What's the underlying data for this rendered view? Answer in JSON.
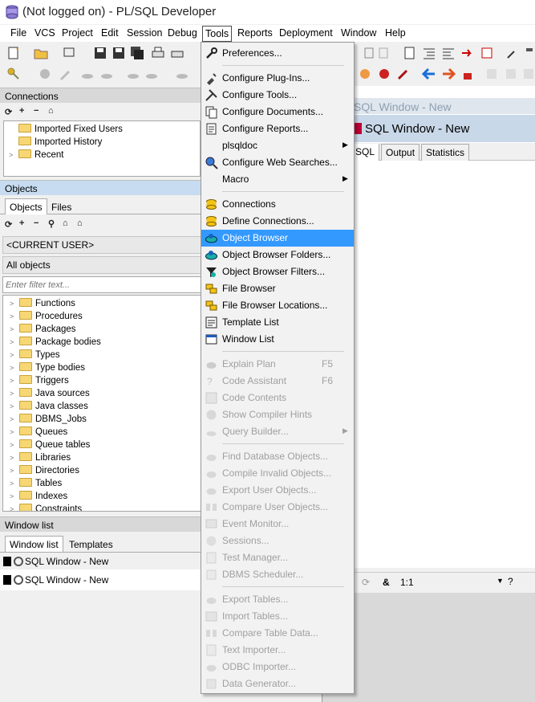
{
  "window": {
    "title": "(Not logged on) - PL/SQL Developer"
  },
  "menubar": {
    "items": [
      "File",
      "VCS",
      "Project",
      "Edit",
      "Session",
      "Debug",
      "Tools",
      "Reports",
      "Deployment",
      "Window",
      "Help"
    ]
  },
  "connections": {
    "header": "Connections",
    "items": [
      "Imported Fixed Users",
      "Imported History",
      "Recent"
    ]
  },
  "objects": {
    "header": "Objects",
    "tabs": [
      "Objects",
      "Files"
    ],
    "current_user": "<CURRENT USER>",
    "filter_selector": "All objects",
    "filter_placeholder": "Enter filter text...",
    "tree": [
      "Functions",
      "Procedures",
      "Packages",
      "Package bodies",
      "Types",
      "Type bodies",
      "Triggers",
      "Java sources",
      "Java classes",
      "DBMS_Jobs",
      "Queues",
      "Queue tables",
      "Libraries",
      "Directories",
      "Tables",
      "Indexes",
      "Constraints"
    ]
  },
  "window_list": {
    "header": "Window list",
    "tabs": [
      "Window list",
      "Templates"
    ],
    "items": [
      "SQL Window - New",
      "SQL Window - New"
    ]
  },
  "editor": {
    "title_inactive": "SQL Window - New",
    "title_active": "SQL Window - New",
    "tabs": [
      "SQL",
      "Output",
      "Statistics"
    ],
    "status_ampersand": "&",
    "status_position": "1:1",
    "status_help": "?"
  },
  "tools_menu": {
    "items": [
      {
        "label": "Preferences...",
        "icon": "wrench-icon",
        "enabled": true
      },
      {
        "label": "Configure Plug-Ins...",
        "icon": "plugin-icon",
        "enabled": true
      },
      {
        "label": "Configure Tools...",
        "icon": "tools-icon",
        "enabled": true
      },
      {
        "label": "Configure Documents...",
        "icon": "documents-icon",
        "enabled": true
      },
      {
        "label": "Configure Reports...",
        "icon": "report-icon",
        "enabled": true
      },
      {
        "label": "plsqldoc",
        "icon": "",
        "enabled": true,
        "submenu": true
      },
      {
        "label": "Configure Web Searches...",
        "icon": "web-search-icon",
        "enabled": true
      },
      {
        "label": "Macro",
        "icon": "",
        "enabled": true,
        "submenu": true
      },
      {
        "label": "Connections",
        "icon": "database-icon",
        "enabled": true
      },
      {
        "label": "Define Connections...",
        "icon": "database-icon",
        "enabled": true
      },
      {
        "label": "Object Browser",
        "icon": "object-browser-icon",
        "enabled": true,
        "highlighted": true
      },
      {
        "label": "Object Browser Folders...",
        "icon": "object-browser-icon",
        "enabled": true
      },
      {
        "label": "Object Browser Filters...",
        "icon": "filter-icon",
        "enabled": true
      },
      {
        "label": "File Browser",
        "icon": "file-browser-icon",
        "enabled": true
      },
      {
        "label": "File Browser Locations...",
        "icon": "file-browser-icon",
        "enabled": true
      },
      {
        "label": "Template List",
        "icon": "template-icon",
        "enabled": true
      },
      {
        "label": "Window List",
        "icon": "window-list-icon",
        "enabled": true
      },
      {
        "label": "Explain Plan",
        "shortcut": "F5",
        "icon": "explain-plan-icon",
        "enabled": false
      },
      {
        "label": "Code Assistant",
        "shortcut": "F6",
        "icon": "code-assistant-icon",
        "enabled": false
      },
      {
        "label": "Code Contents",
        "icon": "code-contents-icon",
        "enabled": false
      },
      {
        "label": "Show Compiler Hints",
        "icon": "hint-icon",
        "enabled": false
      },
      {
        "label": "Query Builder...",
        "icon": "query-builder-icon",
        "enabled": false,
        "submenu": true
      },
      {
        "label": "Find Database Objects...",
        "icon": "find-icon",
        "enabled": false
      },
      {
        "label": "Compile Invalid Objects...",
        "icon": "compile-icon",
        "enabled": false
      },
      {
        "label": "Export User Objects...",
        "icon": "export-icon",
        "enabled": false
      },
      {
        "label": "Compare User Objects...",
        "icon": "compare-icon",
        "enabled": false
      },
      {
        "label": "Event Monitor...",
        "icon": "monitor-icon",
        "enabled": false
      },
      {
        "label": "Sessions...",
        "icon": "sessions-icon",
        "enabled": false
      },
      {
        "label": "Test Manager...",
        "icon": "test-icon",
        "enabled": false
      },
      {
        "label": "DBMS Scheduler...",
        "icon": "scheduler-icon",
        "enabled": false
      },
      {
        "label": "Export Tables...",
        "icon": "export-tables-icon",
        "enabled": false
      },
      {
        "label": "Import Tables...",
        "icon": "import-tables-icon",
        "enabled": false
      },
      {
        "label": "Compare Table Data...",
        "icon": "compare-data-icon",
        "enabled": false
      },
      {
        "label": "Text Importer...",
        "icon": "text-importer-icon",
        "enabled": false
      },
      {
        "label": "ODBC Importer...",
        "icon": "odbc-icon",
        "enabled": false
      },
      {
        "label": "Data Generator...",
        "icon": "data-generator-icon",
        "enabled": false
      }
    ]
  }
}
